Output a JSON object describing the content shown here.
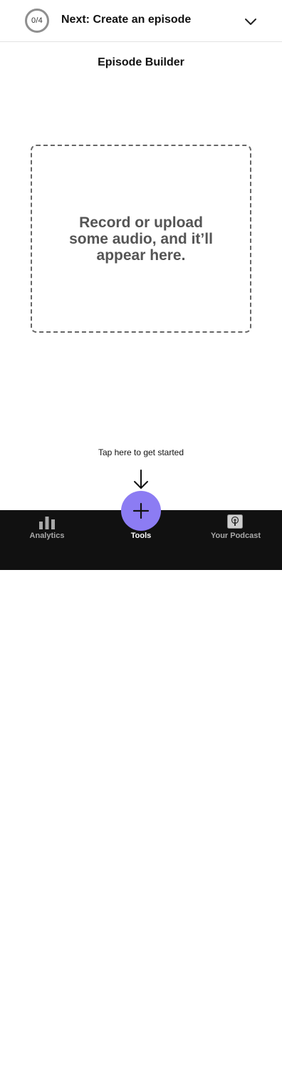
{
  "topbar": {
    "progress": "0/4",
    "next_title": "Next: Create an episode",
    "expand_icon": "chevron-down-icon"
  },
  "page": {
    "title": "Episode Builder"
  },
  "dropzone": {
    "message": "Record or upload some audio, and it’ll appear here."
  },
  "hint": {
    "text": "Tap here to get started",
    "arrow_icon": "arrow-down-icon"
  },
  "fab": {
    "icon": "plus-icon",
    "color": "#8c7cf3"
  },
  "nav": {
    "items": [
      {
        "label": "Analytics",
        "icon": "bar-chart-icon",
        "active": false
      },
      {
        "label": "Tools",
        "icon": "plus-icon",
        "active": true
      },
      {
        "label": "Your Podcast",
        "icon": "podcast-icon",
        "active": false
      }
    ]
  },
  "colors": {
    "accent": "#8c7cf3",
    "nav_background": "#111111",
    "nav_active_label": "#ffffff",
    "nav_inactive_label": "#a8a8a8"
  }
}
